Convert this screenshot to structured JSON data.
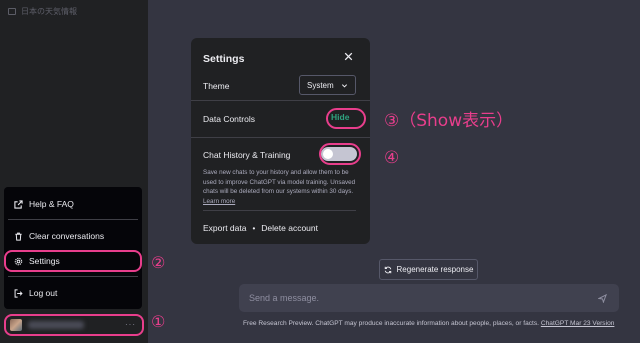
{
  "sidebar": {
    "history_item": "日本の天気情報",
    "menu": {
      "help": "Help & FAQ",
      "clear": "Clear conversations",
      "settings": "Settings",
      "logout": "Log out"
    },
    "user_dots": "···"
  },
  "modal": {
    "title": "Settings",
    "theme_label": "Theme",
    "theme_value": "System",
    "data_controls_label": "Data Controls",
    "hide_label": "Hide",
    "history_label": "Chat History & Training",
    "history_enabled": false,
    "help_text": "Save new chats to your history and allow them to be used to improve ChatGPT via model training. Unsaved chats will be deleted from our systems within 30 days.",
    "learn_more": "Learn more",
    "export_label": "Export data",
    "separator": "•",
    "delete_label": "Delete account"
  },
  "main": {
    "regenerate_label": "Regenerate response",
    "composer_placeholder": "Send a message.",
    "disclaimer": "Free Research Preview. ChatGPT may produce inaccurate information about people, places, or facts.",
    "version_link": "ChatGPT Mar 23 Version"
  },
  "annotations": {
    "a1": "①",
    "a2": "②",
    "a3": "③（Show表示）",
    "a4": "④"
  },
  "colors": {
    "accent_green": "#2ea37f",
    "highlight_pink": "#e83e8c",
    "sidebar_bg": "#202123",
    "main_bg": "#343541"
  }
}
